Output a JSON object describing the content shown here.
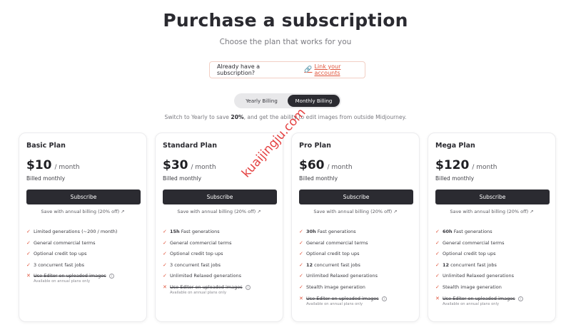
{
  "header": {
    "title": "Purchase a subscription",
    "subtitle": "Choose the plan that works for you"
  },
  "existing": {
    "text": "Already have a subscription?",
    "link_label": "Link your accounts"
  },
  "billing_toggle": {
    "options": [
      "Yearly Billing",
      "Monthly Billing"
    ],
    "selected": "Monthly Billing"
  },
  "note": {
    "prefix": "Switch to Yearly to save ",
    "highlight": "20%",
    "suffix": ", and get the ability to edit images from outside Midjourney."
  },
  "plans": [
    {
      "name": "Basic Plan",
      "price": "$10",
      "per": "/ month",
      "billed": "Billed monthly",
      "subscribe": "Subscribe",
      "save": "Save with annual billing (20% off) ↗",
      "features": [
        {
          "bold": "",
          "text": "Limited generations (~200 / month)"
        },
        {
          "bold": "",
          "text": "General commercial terms"
        },
        {
          "bold": "",
          "text": "Optional credit top ups"
        },
        {
          "bold": "",
          "text": "3 concurrent fast jobs"
        }
      ],
      "disabled": {
        "text": "Use Editor on uploaded images",
        "note": "Available on annual plans only"
      }
    },
    {
      "name": "Standard Plan",
      "price": "$30",
      "per": "/ month",
      "billed": "Billed monthly",
      "subscribe": "Subscribe",
      "save": "Save with annual billing (20% off) ↗",
      "features": [
        {
          "bold": "15h",
          "text": " Fast generations"
        },
        {
          "bold": "",
          "text": "General commercial terms"
        },
        {
          "bold": "",
          "text": "Optional credit top ups"
        },
        {
          "bold": "",
          "text": "3 concurrent fast jobs"
        },
        {
          "bold": "",
          "text": "Unlimited Relaxed generations"
        }
      ],
      "disabled": {
        "text": "Use Editor on uploaded images",
        "note": "Available on annual plans only"
      }
    },
    {
      "name": "Pro Plan",
      "price": "$60",
      "per": "/ month",
      "billed": "Billed monthly",
      "subscribe": "Subscribe",
      "save": "Save with annual billing (20% off) ↗",
      "features": [
        {
          "bold": "30h",
          "text": " Fast generations"
        },
        {
          "bold": "",
          "text": "General commercial terms"
        },
        {
          "bold": "",
          "text": "Optional credit top ups"
        },
        {
          "bold": "12",
          "text": " concurrent fast jobs"
        },
        {
          "bold": "",
          "text": "Unlimited Relaxed generations"
        },
        {
          "bold": "",
          "text": "Stealth image generation"
        }
      ],
      "disabled": {
        "text": "Use Editor on uploaded images",
        "note": "Available on annual plans only"
      }
    },
    {
      "name": "Mega Plan",
      "price": "$120",
      "per": "/ month",
      "billed": "Billed monthly",
      "subscribe": "Subscribe",
      "save": "Save with annual billing (20% off) ↗",
      "features": [
        {
          "bold": "60h",
          "text": " Fast generations"
        },
        {
          "bold": "",
          "text": "General commercial terms"
        },
        {
          "bold": "",
          "text": "Optional credit top ups"
        },
        {
          "bold": "12",
          "text": " concurrent fast jobs"
        },
        {
          "bold": "",
          "text": "Unlimited Relaxed generations"
        },
        {
          "bold": "",
          "text": "Stealth image generation"
        }
      ],
      "disabled": {
        "text": "Use Editor on uploaded images",
        "note": "Available on annual plans only"
      }
    }
  ],
  "watermark": "kuaijingju.com",
  "colors": {
    "accent": "#e0533a",
    "dark": "#2b2b31"
  }
}
